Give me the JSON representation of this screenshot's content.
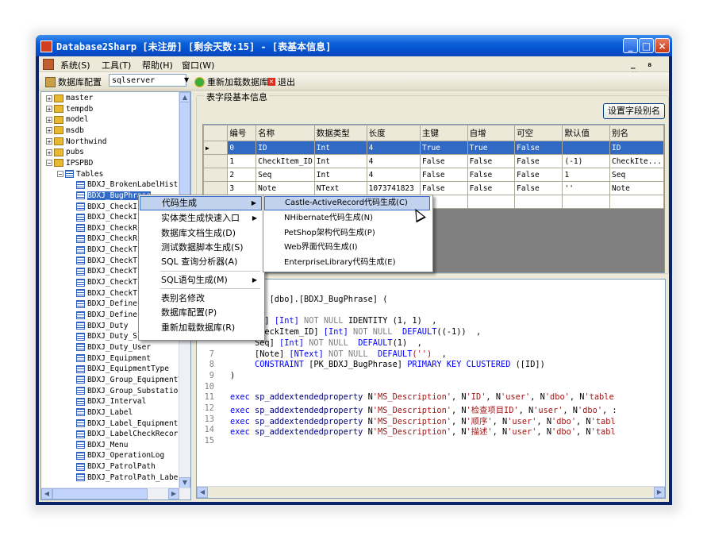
{
  "window": {
    "title": "Database2Sharp [未注册] [剩余天数:15] - [表基本信息]",
    "minimize": "_",
    "maximize": "□",
    "close": "×",
    "mdi_controls": "_ ₈ ×"
  },
  "menu": [
    "系统(S)",
    "工具(T)",
    "帮助(H)",
    "窗口(W)"
  ],
  "toolbar": {
    "db_config": "数据库配置",
    "db_type": "sqlserver",
    "reload": "重新加载数据库",
    "exit": "退出"
  },
  "tree": {
    "databases": [
      "master",
      "tempdb",
      "model",
      "msdb",
      "Northwind",
      "pubs",
      "IPSPBD"
    ],
    "tables_label": "Tables",
    "tables": [
      "BDXJ_BrokenLabelHisto:",
      "BDXJ_BugPhrase",
      "BDXJ_CheckI",
      "BDXJ_CheckI",
      "BDXJ_CheckR",
      "BDXJ_CheckR",
      "BDXJ_CheckT",
      "BDXJ_CheckT",
      "BDXJ_CheckT",
      "BDXJ_CheckT",
      "BDXJ_CheckT",
      "BDXJ_Define",
      "BDXJ_Define",
      "BDXJ_Duty",
      "BDXJ_Duty_S",
      "BDXJ_Duty_User",
      "BDXJ_Equipment",
      "BDXJ_EquipmentType",
      "BDXJ_Group_EquipmentT:",
      "BDXJ_Group_Substation",
      "BDXJ_Interval",
      "BDXJ_Label",
      "BDXJ_Label_Equipment",
      "BDXJ_LabelCheckRecord",
      "BDXJ_Menu",
      "BDXJ_OperationLog",
      "BDXJ_PatrolPath",
      "BDXJ_PatrolPath_Label"
    ]
  },
  "fields": {
    "group_title": "表字段基本信息",
    "alias_button": "设置字段别名",
    "columns": [
      "编号",
      "名称",
      "数据类型",
      "长度",
      "主键",
      "自增",
      "可空",
      "默认值",
      "别名"
    ],
    "rows": [
      [
        "0",
        "ID",
        "Int",
        "4",
        "True",
        "True",
        "False",
        "",
        "ID"
      ],
      [
        "1",
        "CheckItem_ID",
        "Int",
        "4",
        "False",
        "False",
        "False",
        "(-1)",
        "CheckIte..."
      ],
      [
        "2",
        "Seq",
        "Int",
        "4",
        "False",
        "False",
        "False",
        "1",
        "Seq"
      ],
      [
        "3",
        "Note",
        "NText",
        "1073741823",
        "False",
        "False",
        "False",
        "''",
        "Note"
      ]
    ]
  },
  "context_menu": {
    "items": [
      "代码生成",
      "实体类生成快速入口",
      "数据库文档生成(D)",
      "测试数据脚本生成(S)",
      "SQL 查询分析器(A)",
      "SQL语句生成(M)",
      "表别名修改",
      "数据库配置(P)",
      "重新加载数据库(R)"
    ]
  },
  "submenu": {
    "items": [
      "Castle-ActiveRecord代码生成(C)",
      "NHibernate代码生成(N)",
      "PetShop架构代码生成(P)",
      "Web界面代码生成(I)",
      "EnterpriseLibrary代码生成(E)"
    ]
  },
  "code_lines": [
    {
      "n": "",
      "parts": [
        [
          "kw",
          "E TABLE "
        ],
        [
          "txt",
          "[dbo]."
        ],
        [
          "txt",
          "[BDXJ_BugPhrase] "
        ],
        [
          "txt",
          "("
        ]
      ]
    },
    {
      "n": "",
      "parts": []
    },
    {
      "n": "",
      "parts": [
        [
          "txt",
          "ID] "
        ],
        [
          "kw",
          "[Int] "
        ],
        [
          "gray",
          "NOT NULL "
        ],
        [
          "txt",
          "IDENTITY (1, 1)  ,"
        ]
      ]
    },
    {
      "n": "",
      "parts": [
        [
          "txt",
          "CheckItem_ID] "
        ],
        [
          "kw",
          "[Int] "
        ],
        [
          "gray",
          "NOT NULL  "
        ],
        [
          "kw",
          "DEFAULT"
        ],
        [
          "txt",
          "((-1))  ,"
        ]
      ]
    },
    {
      "n": "",
      "parts": [
        [
          "txt",
          "Seq] "
        ],
        [
          "kw",
          "[Int] "
        ],
        [
          "gray",
          "NOT NULL  "
        ],
        [
          "kw",
          "DEFAULT"
        ],
        [
          "txt",
          "(1)  ,"
        ]
      ]
    },
    {
      "n": "7",
      "parts": [
        [
          "txt",
          "[Note] "
        ],
        [
          "kw",
          "[NText] "
        ],
        [
          "gray",
          "NOT NULL  "
        ],
        [
          "kw",
          "DEFAULT"
        ],
        [
          "str",
          "('')"
        ],
        [
          "txt",
          "  ,"
        ]
      ]
    },
    {
      "n": "8",
      "parts": [
        [
          "kw",
          "CONSTRAINT "
        ],
        [
          "txt",
          "[PK_BDXJ_BugPhrase] "
        ],
        [
          "kw",
          "PRIMARY KEY CLUSTERED "
        ],
        [
          "txt",
          "([ID])"
        ]
      ]
    },
    {
      "n": "9",
      "parts": [
        [
          "txt",
          ")"
        ]
      ]
    },
    {
      "n": "10",
      "parts": []
    },
    {
      "n": "11",
      "parts": [
        [
          "kw",
          "exec "
        ],
        [
          "fn",
          "sp_addextendedproperty "
        ],
        [
          "txt",
          "N"
        ],
        [
          "str",
          "'MS_Description'"
        ],
        [
          "txt",
          ", N"
        ],
        [
          "str",
          "'ID'"
        ],
        [
          "txt",
          ", N"
        ],
        [
          "str",
          "'user'"
        ],
        [
          "txt",
          ", N"
        ],
        [
          "str",
          "'dbo'"
        ],
        [
          "txt",
          ", N"
        ],
        [
          "str",
          "'table"
        ]
      ]
    },
    {
      "n": "12",
      "parts": [
        [
          "kw",
          "exec "
        ],
        [
          "fn",
          "sp_addextendedproperty "
        ],
        [
          "txt",
          "N"
        ],
        [
          "str",
          "'MS_Description'"
        ],
        [
          "txt",
          ", N"
        ],
        [
          "str",
          "'检查项目ID'"
        ],
        [
          "txt",
          ", N"
        ],
        [
          "str",
          "'user'"
        ],
        [
          "txt",
          ", N"
        ],
        [
          "str",
          "'dbo'"
        ],
        [
          "txt",
          ", :"
        ]
      ]
    },
    {
      "n": "13",
      "parts": [
        [
          "kw",
          "exec "
        ],
        [
          "fn",
          "sp_addextendedproperty "
        ],
        [
          "txt",
          "N"
        ],
        [
          "str",
          "'MS_Description'"
        ],
        [
          "txt",
          ", N"
        ],
        [
          "str",
          "'顺序'"
        ],
        [
          "txt",
          ", N"
        ],
        [
          "str",
          "'user'"
        ],
        [
          "txt",
          ", N"
        ],
        [
          "str",
          "'dbo'"
        ],
        [
          "txt",
          ", N"
        ],
        [
          "str",
          "'tabl"
        ]
      ]
    },
    {
      "n": "14",
      "parts": [
        [
          "kw",
          "exec "
        ],
        [
          "fn",
          "sp_addextendedproperty "
        ],
        [
          "txt",
          "N"
        ],
        [
          "str",
          "'MS_Description'"
        ],
        [
          "txt",
          ", N"
        ],
        [
          "str",
          "'描述'"
        ],
        [
          "txt",
          ", N"
        ],
        [
          "str",
          "'user'"
        ],
        [
          "txt",
          ", N"
        ],
        [
          "str",
          "'dbo'"
        ],
        [
          "txt",
          ", N"
        ],
        [
          "str",
          "'tabl"
        ]
      ]
    },
    {
      "n": "15",
      "parts": []
    }
  ]
}
